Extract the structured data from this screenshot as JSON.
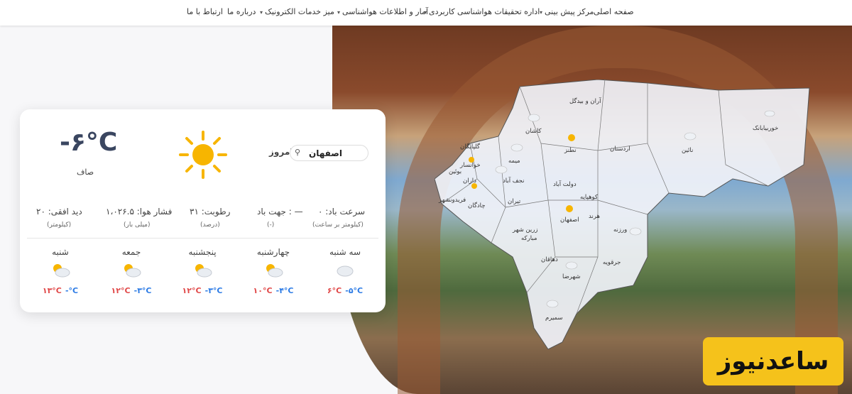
{
  "nav": {
    "home": "صفحه اصلی",
    "forecast": "مرکز پیش بینی",
    "research": "اداره تحقیقات هواشناسی کاربردی",
    "stats": "آمار و اطلاعات هواشناسی",
    "eservices": "میز خدمات الکترونیک",
    "about": "درباره ما",
    "contact": "ارتباط با ما"
  },
  "weather": {
    "today_label": "امروز",
    "city_value": "اصفهان",
    "temperature": "-۶°C",
    "condition": "صاف",
    "stats": {
      "wind_speed": "سرعت باد: ۰",
      "wind_speed_unit": "(کیلومتر بر ساعت)",
      "wind_dir": "جهت باد : —",
      "wind_dir_unit": "(-)",
      "humidity": "رطوبت: ۳۱",
      "humidity_unit": "(درصد)",
      "pressure": "فشار هوا: ۱،۰۲۶.۵",
      "pressure_unit": "(میلی بار)",
      "visibility": "دید افقی: ۲۰",
      "visibility_unit": "(کیلومتر)"
    },
    "forecast": [
      {
        "day": "سه شنبه",
        "low": "-۵°C",
        "high": "۶°C",
        "icon": "cloud-icon"
      },
      {
        "day": "چهارشنبه",
        "low": "-۴°C",
        "high": "۱۰°C",
        "icon": "sun-cloud-icon"
      },
      {
        "day": "پنجشنبه",
        "low": "-۳°C",
        "high": "۱۲°C",
        "icon": "sun-cloud-icon"
      },
      {
        "day": "جمعه",
        "low": "-۳°C",
        "high": "۱۲°C",
        "icon": "sun-cloud-icon"
      },
      {
        "day": "شنبه",
        "low": "-°C",
        "high": "۱۳°C",
        "icon": "sun-cloud-icon"
      }
    ]
  },
  "map_labels": [
    "آران و بیدگل",
    "کاشان",
    "نطنز",
    "اردستان",
    "نائین",
    "خوربیابانک",
    "گلپایگان",
    "خوانسار",
    "بوئین",
    "میمه",
    "دولت آباد",
    "نجف آباد",
    "کوهپایه",
    "داران",
    "فریدونشهر",
    "چادگان",
    "تیران",
    "اصفهان",
    "هرند",
    "ورزنه",
    "زرین شهر",
    "مبارکه",
    "دهاقان",
    "جرقویه",
    "شهرضا",
    "سمیرم"
  ],
  "logo_text": "ساعدنیوز",
  "colors": {
    "accent_blue": "#2c7be5",
    "accent_red": "#e04848",
    "sun": "#f7b500",
    "logo_bg": "#f5c21b"
  }
}
